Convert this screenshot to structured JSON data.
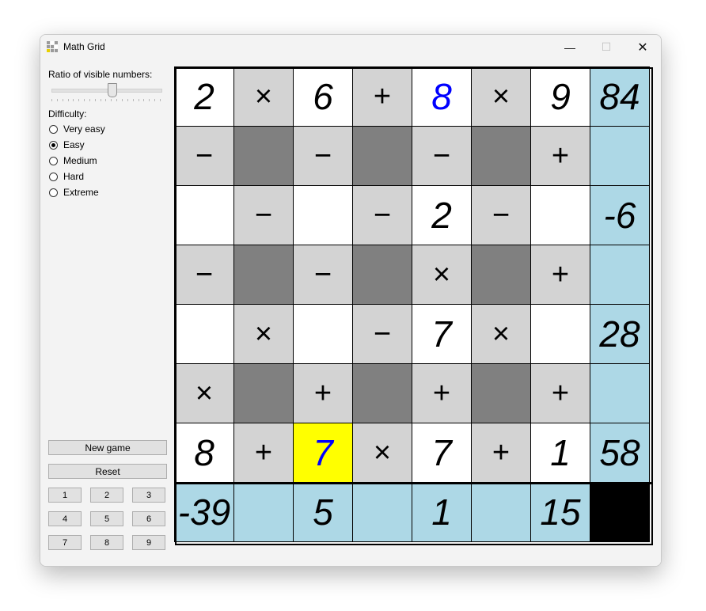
{
  "window": {
    "title": "Math Grid",
    "minimize": "—",
    "maximize": "☐",
    "close": "✕",
    "icon": "grid-app-icon"
  },
  "sidebar": {
    "ratio_label": "Ratio of visible numbers:",
    "ratio_value": 0.55,
    "difficulty_label": "Difficulty:",
    "difficulties": [
      {
        "label": "Very easy",
        "selected": false
      },
      {
        "label": "Easy",
        "selected": true
      },
      {
        "label": "Medium",
        "selected": false
      },
      {
        "label": "Hard",
        "selected": false
      },
      {
        "label": "Extreme",
        "selected": false
      }
    ],
    "new_game": "New game",
    "reset": "Reset",
    "keypad": [
      "1",
      "2",
      "3",
      "4",
      "5",
      "6",
      "7",
      "8",
      "9"
    ]
  },
  "board": {
    "rows": [
      [
        {
          "t": "num",
          "v": "2"
        },
        {
          "t": "op",
          "v": "×"
        },
        {
          "t": "num",
          "v": "6"
        },
        {
          "t": "op",
          "v": "+"
        },
        {
          "t": "num",
          "v": "8",
          "given": true
        },
        {
          "t": "op",
          "v": "×"
        },
        {
          "t": "num",
          "v": "9"
        },
        {
          "t": "result",
          "v": "84"
        }
      ],
      [
        {
          "t": "op",
          "v": "−"
        },
        {
          "t": "dark",
          "v": ""
        },
        {
          "t": "op",
          "v": "−"
        },
        {
          "t": "dark",
          "v": ""
        },
        {
          "t": "op",
          "v": "−"
        },
        {
          "t": "dark",
          "v": ""
        },
        {
          "t": "op",
          "v": "+"
        },
        {
          "t": "result",
          "v": ""
        }
      ],
      [
        {
          "t": "num",
          "v": ""
        },
        {
          "t": "op",
          "v": "−"
        },
        {
          "t": "num",
          "v": ""
        },
        {
          "t": "op",
          "v": "−"
        },
        {
          "t": "num",
          "v": "2"
        },
        {
          "t": "op",
          "v": "−"
        },
        {
          "t": "num",
          "v": ""
        },
        {
          "t": "result",
          "v": "-6"
        }
      ],
      [
        {
          "t": "op",
          "v": "−"
        },
        {
          "t": "dark",
          "v": ""
        },
        {
          "t": "op",
          "v": "−"
        },
        {
          "t": "dark",
          "v": ""
        },
        {
          "t": "op",
          "v": "×"
        },
        {
          "t": "dark",
          "v": ""
        },
        {
          "t": "op",
          "v": "+"
        },
        {
          "t": "result",
          "v": ""
        }
      ],
      [
        {
          "t": "num",
          "v": ""
        },
        {
          "t": "op",
          "v": "×"
        },
        {
          "t": "num",
          "v": ""
        },
        {
          "t": "op",
          "v": "−"
        },
        {
          "t": "num",
          "v": "7"
        },
        {
          "t": "op",
          "v": "×"
        },
        {
          "t": "num",
          "v": ""
        },
        {
          "t": "result",
          "v": "28"
        }
      ],
      [
        {
          "t": "op",
          "v": "×"
        },
        {
          "t": "dark",
          "v": ""
        },
        {
          "t": "op",
          "v": "+"
        },
        {
          "t": "dark",
          "v": ""
        },
        {
          "t": "op",
          "v": "+"
        },
        {
          "t": "dark",
          "v": ""
        },
        {
          "t": "op",
          "v": "+"
        },
        {
          "t": "result",
          "v": ""
        }
      ],
      [
        {
          "t": "num",
          "v": "8"
        },
        {
          "t": "op",
          "v": "+"
        },
        {
          "t": "num",
          "v": "7",
          "given": true,
          "selected": true
        },
        {
          "t": "op",
          "v": "×"
        },
        {
          "t": "num",
          "v": "7"
        },
        {
          "t": "op",
          "v": "+"
        },
        {
          "t": "num",
          "v": "1"
        },
        {
          "t": "result",
          "v": "58"
        }
      ],
      [
        {
          "t": "result",
          "v": "-39"
        },
        {
          "t": "result",
          "v": ""
        },
        {
          "t": "result",
          "v": "5"
        },
        {
          "t": "result",
          "v": ""
        },
        {
          "t": "result",
          "v": "1"
        },
        {
          "t": "result",
          "v": ""
        },
        {
          "t": "result",
          "v": "15"
        },
        {
          "t": "corner",
          "v": ""
        }
      ]
    ]
  },
  "colors": {
    "selected": "#ffff00",
    "given_digit": "#0000ff",
    "operator_bg": "#d3d3d3",
    "blocked_bg": "#808080",
    "result_bg": "#add8e6"
  }
}
